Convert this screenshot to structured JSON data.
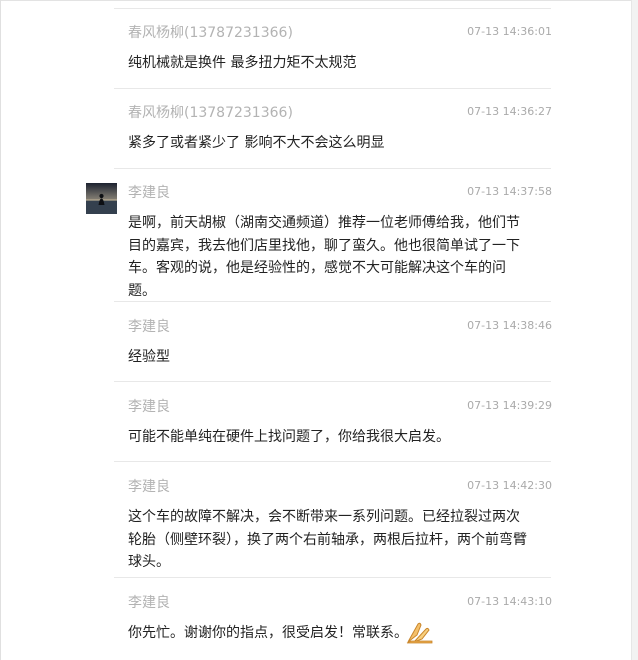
{
  "messages": [
    {
      "name": "春风杨柳(13787231366)",
      "time": "07-13 14:36:01",
      "text": "纯机械就是换件  最多扭力矩不太规范"
    },
    {
      "name": "春风杨柳(13787231366)",
      "time": "07-13 14:36:27",
      "text": "紧多了或者紧少了 影响不大不会这么明显"
    },
    {
      "name": "李建良",
      "time": "07-13 14:37:58",
      "text": "是啊，前天胡椒（湖南交通频道）推荐一位老师傅给我，他们节目的嘉宾，我去他们店里找他，聊了蛮久。他也很简单试了一下车。客观的说，他是经验性的，感觉不大可能解决这个车的问题。"
    },
    {
      "name": "李建良",
      "time": "07-13 14:38:46",
      "text": "经验型"
    },
    {
      "name": "李建良",
      "time": "07-13 14:39:29",
      "text": "可能不能单纯在硬件上找问题了，你给我很大启发。"
    },
    {
      "name": "李建良",
      "time": "07-13 14:42:30",
      "text": "这个车的故障不解决，会不断带来一系列问题。已经拉裂过两次轮胎（侧壁环裂），换了两个右前轴承，两根后拉杆，两个前弯臂球头。"
    },
    {
      "name": "李建良",
      "time": "07-13 14:43:10",
      "text": "你先忙。谢谢你的指点，很受启发！常联系。"
    }
  ],
  "icons": {
    "avatar": "avatar-silhouette-icon",
    "emoji": "praying-hands-emoji-icon"
  }
}
